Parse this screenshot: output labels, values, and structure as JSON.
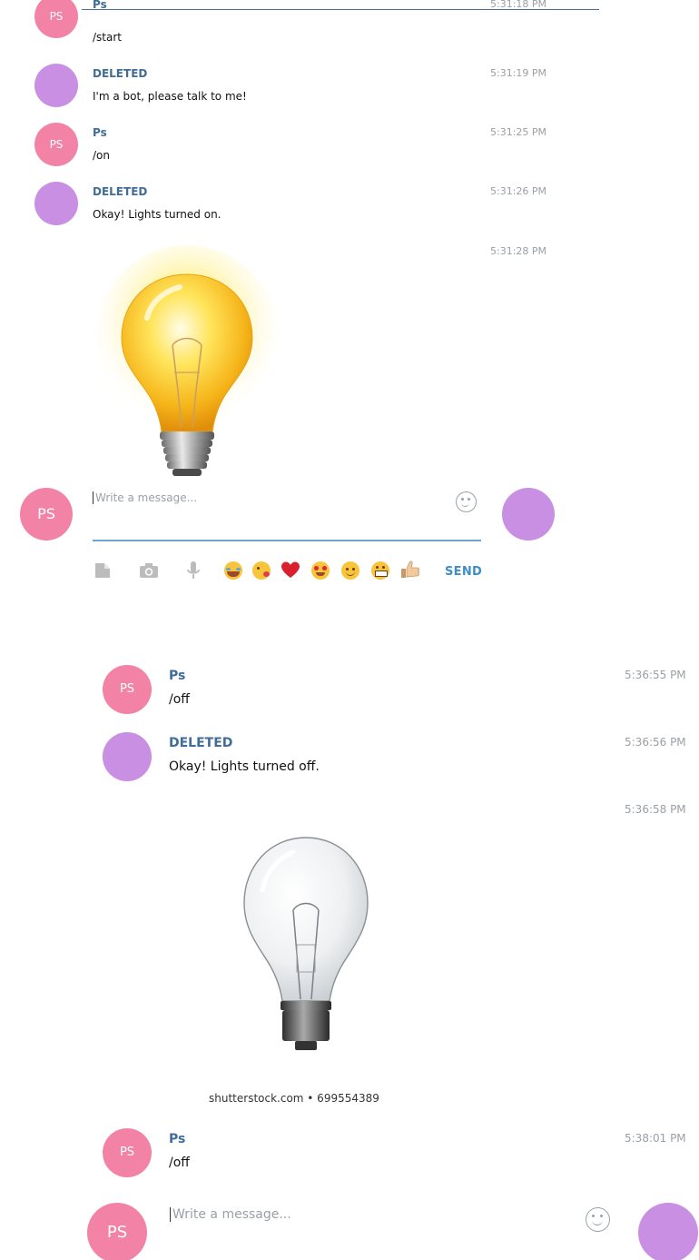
{
  "top_panel": {
    "messages": [
      {
        "initials": "PS",
        "author": "Ps",
        "text": "/start",
        "time": "5:31:18 PM",
        "kind": "ps"
      },
      {
        "initials": "",
        "author": "DELETED",
        "text": "I'm a bot, please talk to me!",
        "time": "5:31:19 PM",
        "kind": "del"
      },
      {
        "initials": "PS",
        "author": "Ps",
        "text": "/on",
        "time": "5:31:25 PM",
        "kind": "ps"
      },
      {
        "initials": "",
        "author": "DELETED",
        "text": "Okay! Lights turned on.",
        "time": "5:31:26 PM",
        "kind": "del"
      }
    ],
    "photo_time": "5:31:28 PM",
    "photo_icon": "light-bulb-on",
    "composer": {
      "initials": "PS",
      "placeholder": "Write a message...",
      "send_label": "SEND",
      "tool_icons": [
        "file-icon",
        "camera-icon",
        "microphone-icon"
      ],
      "emoji_icons": [
        "joy-emoji",
        "kiss-emoji",
        "heart-emoji",
        "heart-eyes-emoji",
        "smile-emoji",
        "grin-emoji",
        "thumbs-up-emoji"
      ]
    }
  },
  "bottom_panel": {
    "messages": [
      {
        "initials": "PS",
        "author": "Ps",
        "text": "/off",
        "time": "5:36:55 PM",
        "kind": "ps"
      },
      {
        "initials": "",
        "author": "DELETED",
        "text": "Okay! Lights turned off.",
        "time": "5:36:56 PM",
        "kind": "del"
      }
    ],
    "photo_time": "5:36:58 PM",
    "photo_icon": "light-bulb-off",
    "photo_credit": "shutterstock.com • 699554389",
    "last_message": {
      "initials": "PS",
      "author": "Ps",
      "text": "/off",
      "time": "5:38:01 PM",
      "kind": "ps"
    },
    "composer": {
      "initials": "PS",
      "placeholder": "Write a message..."
    }
  },
  "colors": {
    "ps_avatar": "#f283a6",
    "deleted_avatar": "#c98fe3",
    "author_name": "#3f6d97",
    "timestamp": "#9aa0a6",
    "send": "#3d8ec9",
    "input_underline": "#6da6cf"
  }
}
